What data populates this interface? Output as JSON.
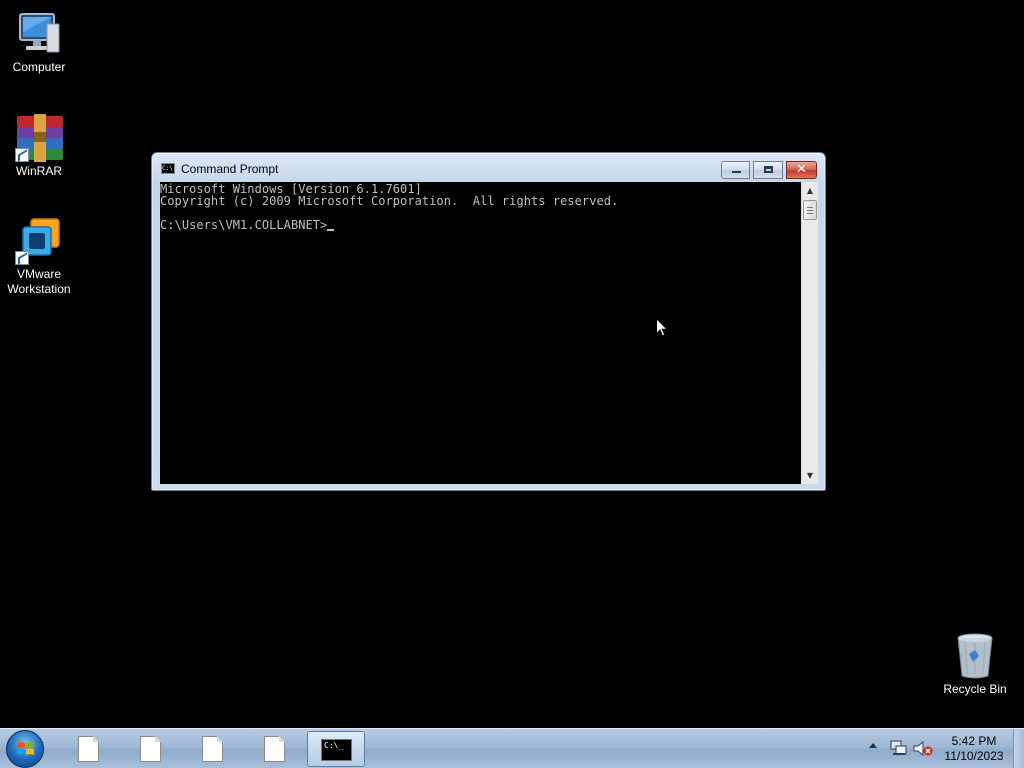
{
  "desktop": {
    "icons": [
      {
        "label": "Computer"
      },
      {
        "label": "WinRAR"
      },
      {
        "label_line1": "VMware",
        "label_line2": "Workstation"
      },
      {
        "label": "Recycle Bin"
      }
    ]
  },
  "window": {
    "title": "Command Prompt",
    "buttons": {
      "minimize": "minimize-icon",
      "maximize": "maximize-icon",
      "close": "✕"
    },
    "console_lines": [
      "Microsoft Windows [Version 6.1.7601]",
      "Copyright (c) 2009 Microsoft Corporation.  All rights reserved.",
      "",
      "C:\\Users\\VM1.COLLABNET>"
    ],
    "console_fg": "#c0c0c0",
    "console_bg": "#000000"
  },
  "taskbar": {
    "icon_names": [
      "start-orb",
      "document-icon",
      "document-icon",
      "document-icon",
      "document-icon",
      "command-prompt-icon"
    ],
    "cmd_icon_text": "C:\\_",
    "tray_icons": [
      "show-hidden-icons-arrow",
      "network-icon",
      "volume-muted-icon"
    ],
    "clock": {
      "time": "5:42 PM",
      "date": "11/10/2023"
    }
  },
  "colors": {
    "desktop_bg": "#000000",
    "taskbar": "#9fb8d4",
    "close_button": "#c0392b"
  }
}
